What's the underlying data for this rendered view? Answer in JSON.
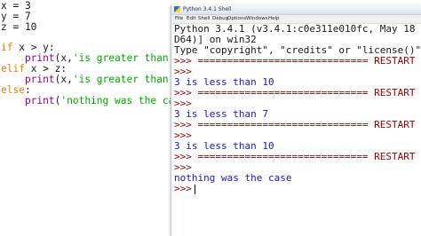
{
  "editor": {
    "lines": {
      "l1": "x = 3",
      "l2": "y = 7",
      "l3": "z = 10",
      "l5a": "if",
      "l5b": " x > y:",
      "l6a": "    print",
      "l6b": "(x,",
      "l6c": "'is greater than',",
      "l7a": "elif",
      "l7b": " x > z:",
      "l8a": "    print",
      "l8b": "(x,",
      "l8c": "'is greater than',",
      "l9a": "else",
      "l9b": ":",
      "l10a": "    print",
      "l10b": "(",
      "l10c": "'nothing was the case"
    }
  },
  "shell": {
    "title": "Python 3.4.1 Shell",
    "menu": [
      "File",
      "Edit",
      "Shell",
      "Debug",
      "Options",
      "Windows",
      "Help"
    ],
    "banner1": "Python 3.4.1 (v3.4.1:c0e311e010fc, May 18 20",
    "banner2": "D64)] on win32",
    "banner3": "Type \"copyright\", \"credits\" or \"license()\" f",
    "prompt": ">>>",
    "restart_line": " ============================= RESTART",
    "out1": "3 is less than 10",
    "out2": "3 is less than 7",
    "out3": "3 is less than 10",
    "out4": "nothing was the case"
  }
}
